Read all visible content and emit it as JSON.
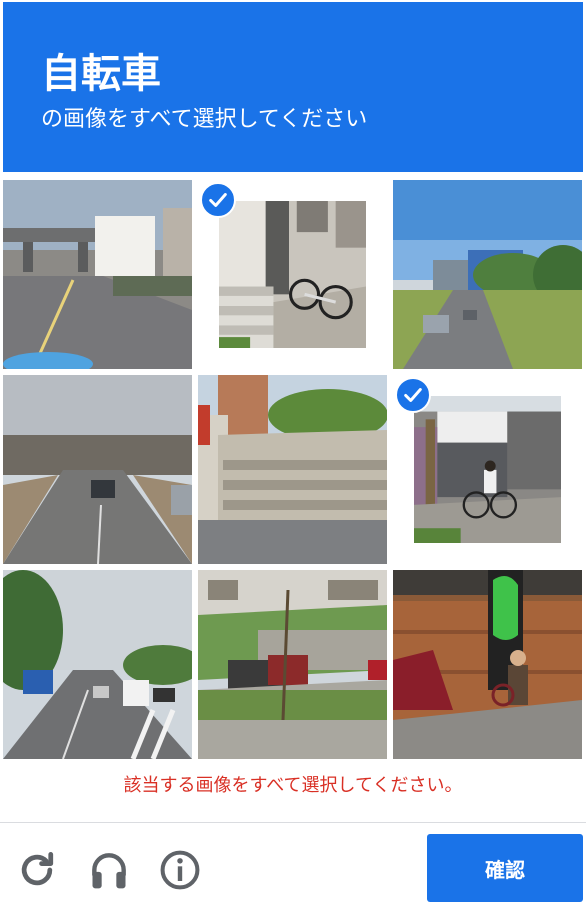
{
  "header": {
    "title": "自転車",
    "subtitle": "の画像をすべて選択してください"
  },
  "grid": {
    "tiles": [
      {
        "scene": "highway-overpass-street",
        "selected": false
      },
      {
        "scene": "bicycle-parked-by-steps",
        "selected": true
      },
      {
        "scene": "road-with-buildings-and-car",
        "selected": false
      },
      {
        "scene": "wide-road-overcast",
        "selected": false
      },
      {
        "scene": "stone-steps-plaza",
        "selected": false
      },
      {
        "scene": "cyclist-by-storefront",
        "selected": true
      },
      {
        "scene": "tree-lined-road-traffic",
        "selected": false
      },
      {
        "scene": "parking-lot-cars",
        "selected": false
      },
      {
        "scene": "pedestrian-by-brick-wall",
        "selected": false
      }
    ]
  },
  "error_message": "該当する画像をすべて選択してください。",
  "footer": {
    "icons": [
      "reload-icon",
      "headphones-icon",
      "info-icon"
    ],
    "verify_label": "確認"
  },
  "colors": {
    "brand": "#1a73e8",
    "error": "#d93025"
  }
}
